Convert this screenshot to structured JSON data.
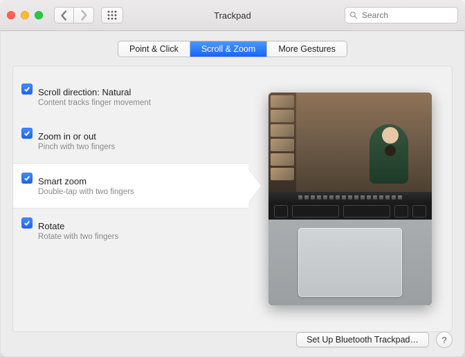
{
  "header": {
    "title": "Trackpad",
    "search_placeholder": "Search"
  },
  "tabs": [
    {
      "label": "Point & Click",
      "active": false,
      "name": "tab-point-click"
    },
    {
      "label": "Scroll & Zoom",
      "active": true,
      "name": "tab-scroll-zoom"
    },
    {
      "label": "More Gestures",
      "active": false,
      "name": "tab-more-gestures"
    }
  ],
  "options": [
    {
      "label": "Scroll direction: Natural",
      "sub": "Content tracks finger movement",
      "checked": true,
      "selected": false,
      "name": "option-scroll-direction"
    },
    {
      "label": "Zoom in or out",
      "sub": "Pinch with two fingers",
      "checked": true,
      "selected": false,
      "name": "option-zoom"
    },
    {
      "label": "Smart zoom",
      "sub": "Double-tap with two fingers",
      "checked": true,
      "selected": true,
      "name": "option-smart-zoom"
    },
    {
      "label": "Rotate",
      "sub": "Rotate with two fingers",
      "checked": true,
      "selected": false,
      "name": "option-rotate"
    }
  ],
  "footer": {
    "setup_button": "Set Up Bluetooth Trackpad…",
    "help": "?"
  }
}
